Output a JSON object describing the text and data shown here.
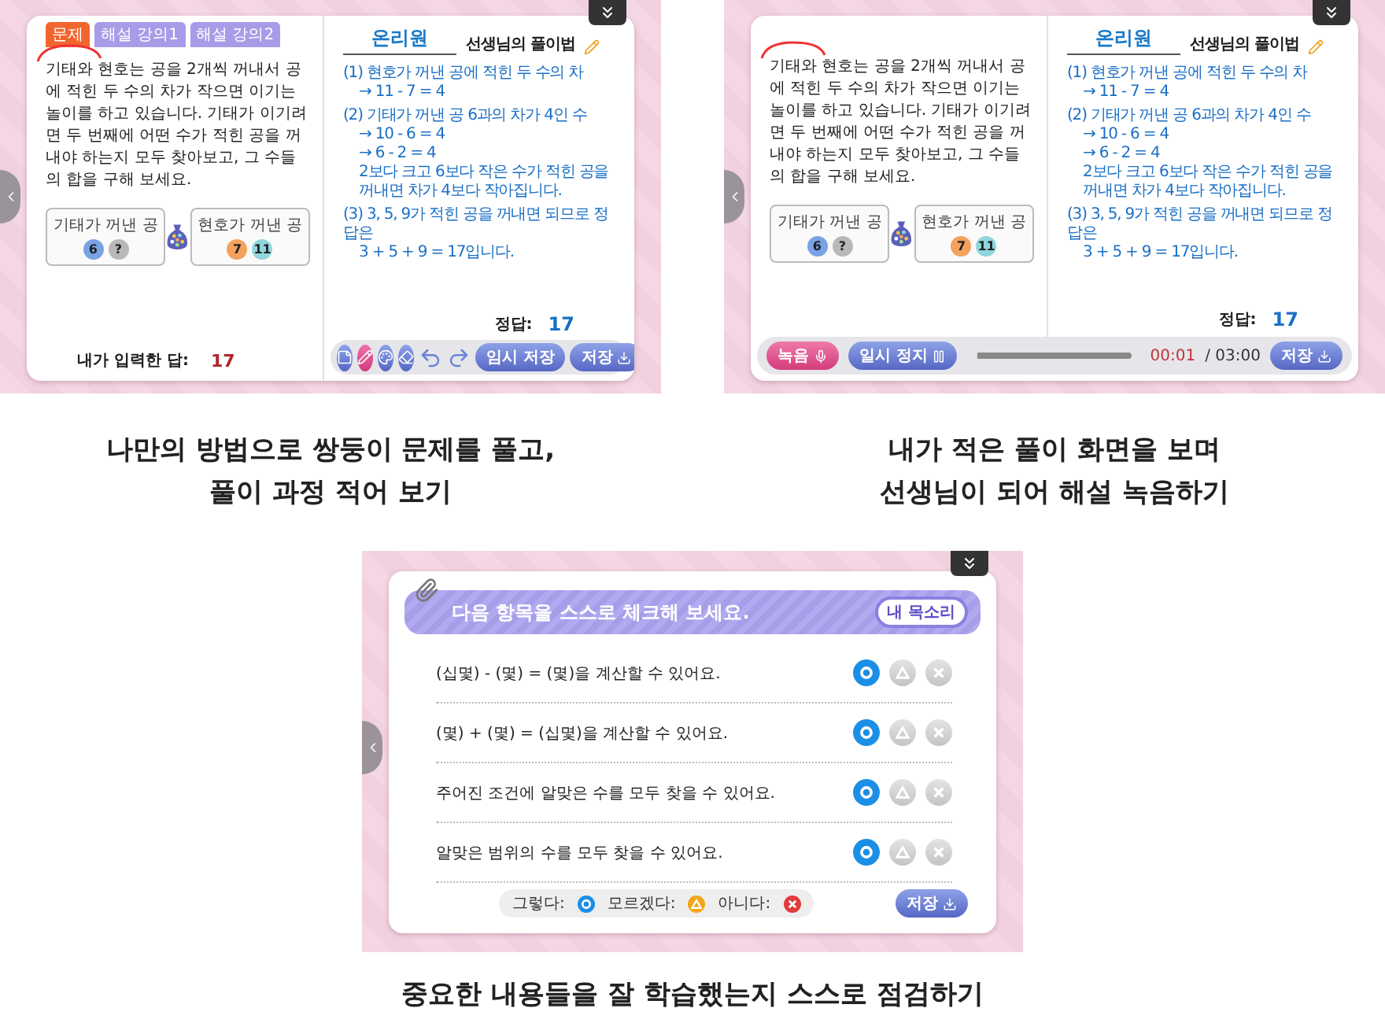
{
  "solve_screen": {
    "tabs": [
      {
        "label": "문제",
        "selected": true
      },
      {
        "label": "해설 강의1",
        "selected": false
      },
      {
        "label": "해설 강의2",
        "selected": false
      }
    ],
    "problem": "기태와 현호는 공을 2개씩 꺼내서 공에 적힌 두 수의 차가 작으면 이기는 놀이를 하고 있습니다. 기태가 이기려면 두 번째에 어떤 수가 적힌 공을 꺼내야 하는지 모두 찾아보고, 그 수들의 합을 구해 보세요.",
    "figure": {
      "left": {
        "label": "기태가 꺼낸 공",
        "balls": [
          "6",
          "?"
        ]
      },
      "right": {
        "label": "현호가 꺼낸 공",
        "balls": [
          "7",
          "11"
        ]
      }
    },
    "my_answer": {
      "label": "내가 입력한 답:",
      "value": "17"
    },
    "solution": {
      "author": "온리원",
      "title": "선생님의 풀이법",
      "steps": [
        {
          "lines": [
            "(1) 현호가 꺼낸 공에 적힌 두 수의 차",
            "→ 11 - 7 = 4"
          ]
        },
        {
          "lines": [
            "(2) 기태가 꺼낸 공 6과의 차가 4인 수",
            "→ 10 - 6 = 4",
            "→ 6 - 2 = 4",
            "2보다 크고 6보다 작은 수가 적힌 공을",
            "꺼내면 차가 4보다 작아집니다."
          ]
        },
        {
          "lines": [
            "(3) 3, 5, 9가 적힌 공을 꺼내면 되므로 정답은",
            "3 + 5 + 9 = 17입니다."
          ]
        }
      ],
      "answer_label": "정답:",
      "answer": "17"
    },
    "tools": [
      {
        "kind": "memo",
        "selected": false
      },
      {
        "kind": "pen",
        "selected": true
      },
      {
        "kind": "palette",
        "selected": false
      },
      {
        "kind": "eraser",
        "selected": false
      },
      {
        "kind": "undo",
        "selected": false
      },
      {
        "kind": "redo",
        "selected": false
      }
    ],
    "temp_save": "임시 저장",
    "save": "저장"
  },
  "record_screen": {
    "problem": "기태와 현호는 공을 2개씩 꺼내서 공에 적힌 두 수의 차가 작으면 이기는 놀이를 하고 있습니다. 기태가 이기려면 두 번째에 어떤 수가 적힌 공을 꺼내야 하는지 모두 찾아보고, 그 수들의 합을 구해 보세요.",
    "figure": {
      "left": {
        "label": "기태가 꺼낸 공",
        "balls": [
          "6",
          "?"
        ]
      },
      "right": {
        "label": "현호가 꺼낸 공",
        "balls": [
          "7",
          "11"
        ]
      }
    },
    "solution": {
      "author": "온리원",
      "title": "선생님의 풀이법",
      "steps": [
        {
          "lines": [
            "(1) 현호가 꺼낸 공에 적힌 두 수의 차",
            "→ 11 - 7 = 4"
          ]
        },
        {
          "lines": [
            "(2) 기태가 꺼낸 공 6과의 차가 4인 수",
            "→ 10 - 6 = 4",
            "→ 6 - 2 = 4",
            "2보다 크고 6보다 작은 수가 적힌 공을",
            "꺼내면 차가 4보다 작아집니다."
          ]
        },
        {
          "lines": [
            "(3) 3, 5, 9가 적힌 공을 꺼내면 되므로 정답은",
            "3 + 5 + 9 = 17입니다."
          ]
        }
      ],
      "answer_label": "정답:",
      "answer": "17"
    },
    "record": "녹음",
    "pause": "일시 정지",
    "progress": {
      "level": 0.01
    },
    "elapsed": "00:01",
    "total": "/ 03:00",
    "save": "저장"
  },
  "captions": [
    "나만의 방법으로 쌍둥이 문제를 풀고,\n풀이 과정 적어 보기",
    "내가 적은 풀이 화면을 보며\n선생님이 되어 해설 녹음하기"
  ],
  "check_screen": {
    "title": "다음 항목을 스스로 체크해 보세요.",
    "voice_button": "내 목소리",
    "rows": [
      {
        "text": "(십몇) - (몇) = (몇)을 계산할 수 있어요.",
        "marks": [
          {
            "kind": "circle",
            "selected": true
          },
          {
            "kind": "triangle",
            "selected": false
          },
          {
            "kind": "cross",
            "selected": false
          }
        ]
      },
      {
        "text": "(몇) + (몇) = (십몇)을 계산할 수 있어요.",
        "marks": [
          {
            "kind": "circle",
            "selected": true
          },
          {
            "kind": "triangle",
            "selected": false
          },
          {
            "kind": "cross",
            "selected": false
          }
        ]
      },
      {
        "text": "주어진 조건에 알맞은 수를 모두 찾을 수 있어요.",
        "marks": [
          {
            "kind": "circle",
            "selected": true
          },
          {
            "kind": "triangle",
            "selected": false
          },
          {
            "kind": "cross",
            "selected": false
          }
        ]
      },
      {
        "text": "알맞은 범위의 수를 모두 찾을 수 있어요.",
        "marks": [
          {
            "kind": "circle",
            "selected": true
          },
          {
            "kind": "triangle",
            "selected": false
          },
          {
            "kind": "cross",
            "selected": false
          }
        ]
      }
    ],
    "legend": [
      {
        "label": "그렇다:",
        "kind": "circle"
      },
      {
        "label": "모르겠다:",
        "kind": "triangle"
      },
      {
        "label": "아니다:",
        "kind": "cross"
      }
    ],
    "save": "저장"
  },
  "bottom_caption": "중요한 내용들을 잘 학습했는지 스스로 점검하기"
}
